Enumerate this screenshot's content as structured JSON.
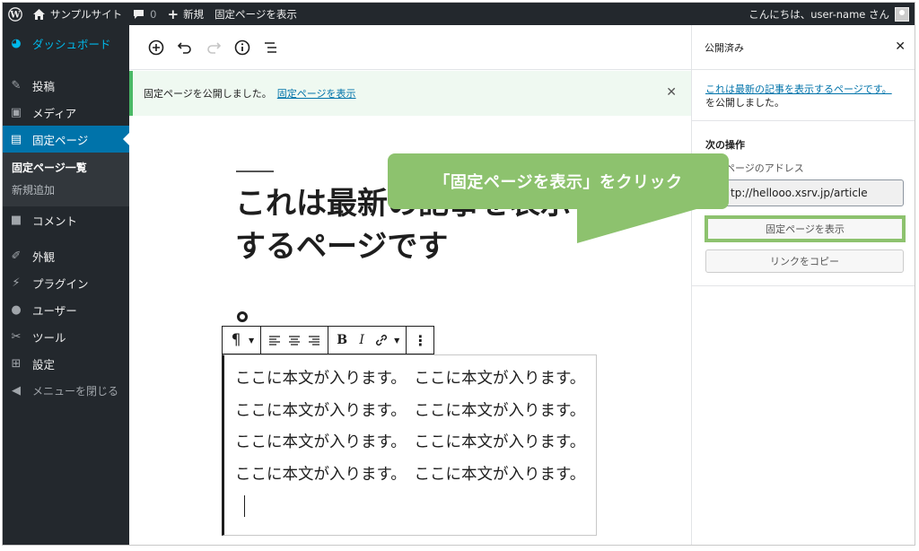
{
  "admin_bar": {
    "site_name": "サンプルサイト",
    "comments_count": "0",
    "new_label": "新規",
    "view_page_label": "固定ページを表示",
    "greeting": "こんにちは、user-name さん"
  },
  "sidebar": {
    "dashboard": "ダッシュボード",
    "items": [
      {
        "label": "投稿",
        "icon": "pin-icon"
      },
      {
        "label": "メディア",
        "icon": "media-icon"
      },
      {
        "label": "固定ページ",
        "icon": "pages-icon"
      },
      {
        "label": "コメント",
        "icon": "comment-icon"
      },
      {
        "label": "外観",
        "icon": "appearance-icon"
      },
      {
        "label": "プラグイン",
        "icon": "plugin-icon"
      },
      {
        "label": "ユーザー",
        "icon": "user-icon"
      },
      {
        "label": "ツール",
        "icon": "tools-icon"
      },
      {
        "label": "設定",
        "icon": "settings-icon"
      }
    ],
    "submenu": [
      "固定ページ一覧",
      "新規追加"
    ],
    "collapse": "メニューを閉じる"
  },
  "notice": {
    "text": "固定ページを公開しました。",
    "link": "固定ページを表示"
  },
  "post": {
    "title": "これは最新の記事を表示するページです",
    "body": "ここに本文が入ります。　ここに本文が入ります。　ここに本文が入ります。　ここに本文が入ります。　ここに本文が入ります。　ここに本文が入ります。　ここに本文が入ります。　ここに本文が入ります。"
  },
  "callout": {
    "text": "「固定ページを表示」をクリック",
    "color": "#8dc26e"
  },
  "panel": {
    "header": "公開済み",
    "published_link": "これは最新の記事を表示するページです。",
    "published_suffix": "を公開しました。",
    "next_title": "次の操作",
    "address_label": "ページのアドレス",
    "url": "tp://hellooo.xsrv.jp/article",
    "view_button": "固定ページを表示",
    "copy_button": "リンクをコピー"
  },
  "colors": {
    "admin_bg": "#23282d",
    "accent": "#0073aa",
    "notice_border": "#4ab866",
    "highlight": "#8dc26e"
  }
}
